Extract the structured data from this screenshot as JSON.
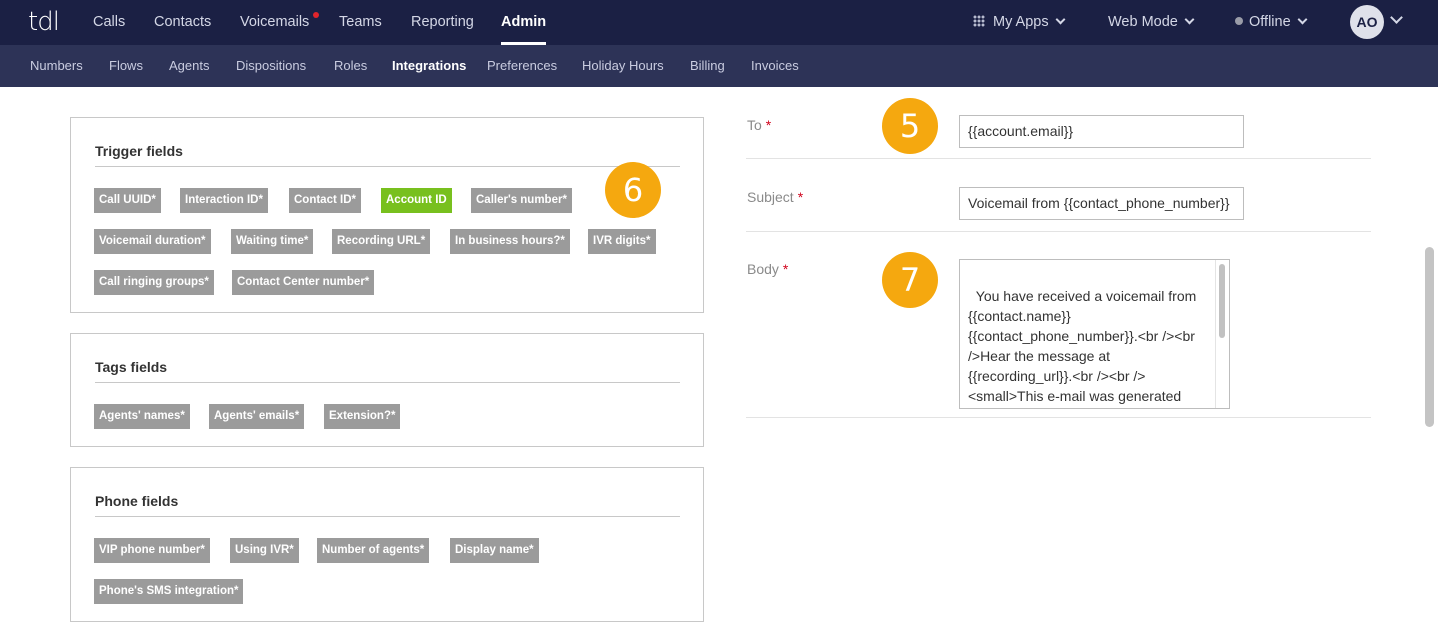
{
  "app": {
    "logo": "tdl"
  },
  "top_nav": {
    "items": [
      "Calls",
      "Contacts",
      "Voicemails",
      "Teams",
      "Reporting",
      "Admin"
    ],
    "active": "Admin",
    "my_apps": "My Apps",
    "mode": "Web Mode",
    "status": "Offline",
    "avatar": "AO"
  },
  "sub_nav": {
    "items": [
      "Numbers",
      "Flows",
      "Agents",
      "Dispositions",
      "Roles",
      "Integrations",
      "Preferences",
      "Holiday Hours",
      "Billing",
      "Invoices"
    ],
    "active": "Integrations"
  },
  "trigger_fields": {
    "title": "Trigger fields",
    "tags": [
      "Call UUID*",
      "Interaction ID*",
      "Contact ID*",
      "Account ID",
      "Caller's number*",
      "Voicemail duration*",
      "Waiting time*",
      "Recording URL*",
      "In business hours?*",
      "IVR digits*",
      "Call ringing groups*",
      "Contact Center number*"
    ],
    "highlighted": "Account ID"
  },
  "tags_fields": {
    "title": "Tags fields",
    "tags": [
      "Agents' names*",
      "Agents' emails*",
      "Extension?*"
    ]
  },
  "phone_fields": {
    "title": "Phone fields",
    "tags": [
      "VIP phone number*",
      "Using IVR*",
      "Number of agents*",
      "Display name*",
      "Phone's SMS integration*"
    ]
  },
  "form": {
    "to_label": "To",
    "to_value": "{{account.email}}",
    "subject_label": "Subject",
    "subject_value": "Voicemail from {{contact_phone_number}}",
    "body_label": "Body",
    "body_value": "You have received a voicemail from {{contact.name}} {{contact_phone_number}}.<br /><br />Hear the message at {{recording_url}}.<br /><br /><small>This e-mail was generated automatically by Talkdesk. You can",
    "required_marker": "*"
  },
  "step_badges": [
    "5",
    "6",
    "7"
  ],
  "colors": {
    "top_nav_bg": "#1b2044",
    "sub_nav_bg": "#2d3357",
    "tag_gray": "#9b9b9b",
    "tag_green": "#78c01e",
    "badge_orange": "#f5a80f",
    "required_red": "#d0021b"
  }
}
